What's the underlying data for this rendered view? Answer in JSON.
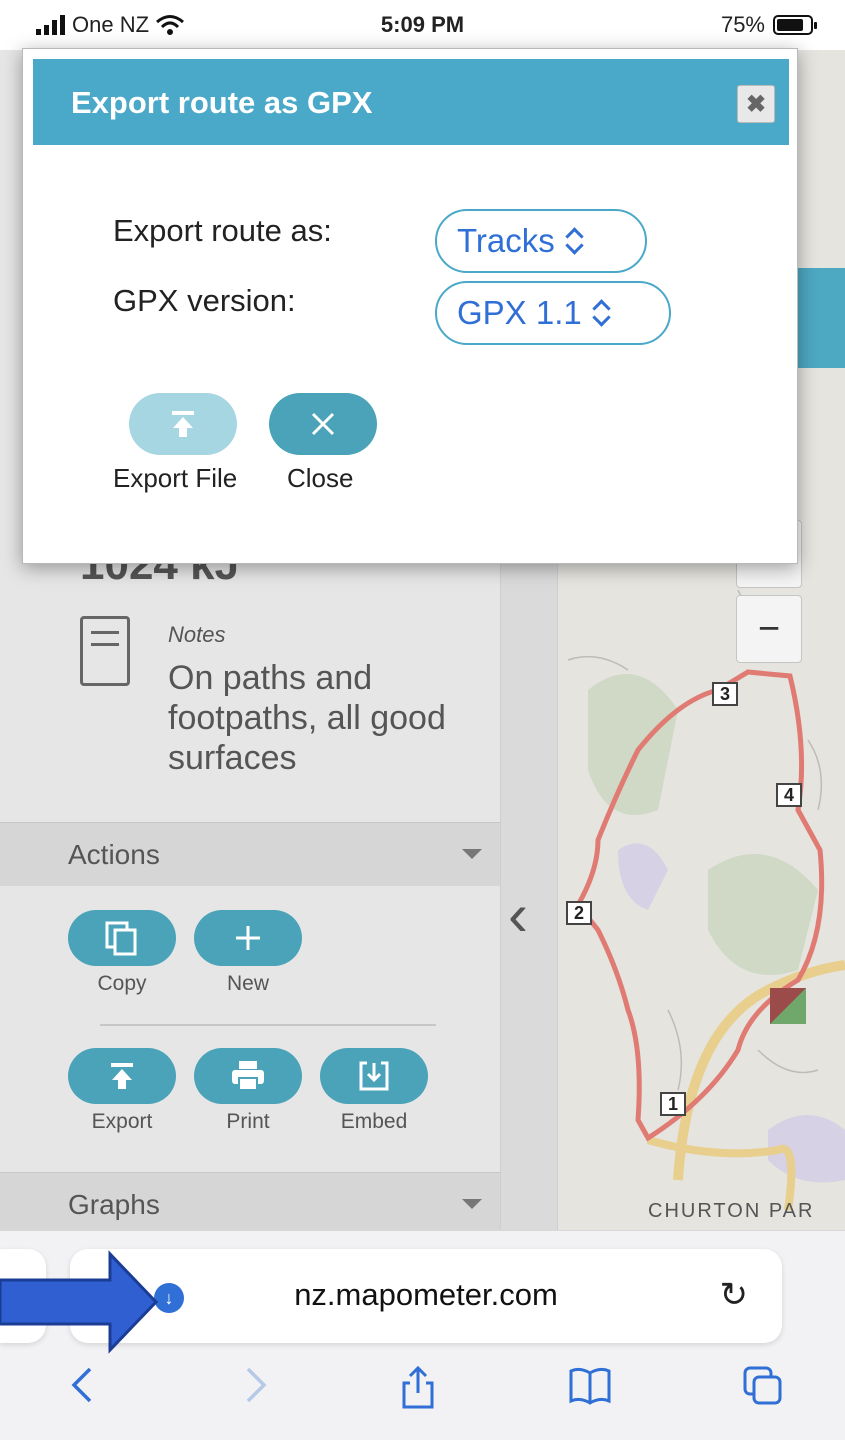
{
  "status_bar": {
    "carrier": "One NZ",
    "time": "5:09 PM",
    "battery": "75%"
  },
  "dialog": {
    "title": "Export route as GPX",
    "close_x": "✖",
    "fields": [
      {
        "label": "Export route as:",
        "value": "Tracks"
      },
      {
        "label": "GPX version:",
        "value": "GPX 1.1"
      }
    ],
    "buttons": [
      {
        "label": "Export File",
        "icon": "upload-icon"
      },
      {
        "label": "Close",
        "icon": "close-icon"
      }
    ]
  },
  "panel": {
    "energy": "1024 kJ",
    "notes_label": "Notes",
    "notes_text": "On paths and footpaths, all good surfaces",
    "sections": {
      "actions": "Actions",
      "graphs": "Graphs"
    },
    "actions": [
      {
        "label": "Copy",
        "icon": "copy-icon"
      },
      {
        "label": "New",
        "icon": "plus-icon"
      },
      {
        "label": "Export",
        "icon": "upload-icon"
      },
      {
        "label": "Print",
        "icon": "printer-icon"
      },
      {
        "label": "Embed",
        "icon": "embed-download-icon"
      }
    ]
  },
  "map": {
    "zoom_out": "−",
    "zoom_in": "+",
    "markers": [
      "1",
      "2",
      "3",
      "4"
    ],
    "place_label": "CHURTON PAR"
  },
  "browser": {
    "url": "nz.mapometer.com",
    "nav": [
      "back-icon",
      "forward-icon",
      "share-icon",
      "bookmarks-icon",
      "tabs-icon"
    ]
  },
  "colors": {
    "accent": "#4aa8c8",
    "button": "#4aa3b8",
    "link": "#2f6fd6",
    "route": "#e07b73",
    "annotation_arrow": "#2f5fd0"
  }
}
